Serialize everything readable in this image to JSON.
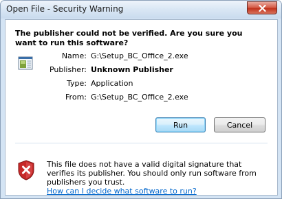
{
  "window": {
    "title": "Open File - Security Warning"
  },
  "main": {
    "heading": "The publisher could not be verified.  Are you sure you want to run this software?",
    "fields": [
      {
        "label": "Name:",
        "value": "G:\\Setup_BC_Office_2.exe",
        "bold": false
      },
      {
        "label": "Publisher:",
        "value": "Unknown Publisher",
        "bold": true
      },
      {
        "label": "Type:",
        "value": "Application",
        "bold": false
      },
      {
        "label": "From:",
        "value": "G:\\Setup_BC_Office_2.exe",
        "bold": false
      }
    ]
  },
  "buttons": {
    "run_label": "Run",
    "cancel_label": "Cancel"
  },
  "footer": {
    "warning_text": "This file does not have a valid digital signature that verifies its publisher.  You should only run software from publishers you trust.",
    "help_link": "How can I decide what software to run?"
  },
  "icons": {
    "close": "close-icon",
    "file": "executable-file-icon",
    "warning": "shield-warning-icon"
  },
  "colors": {
    "link": "#0066cc",
    "shield_red": "#d02a2a",
    "close_button": "#c1331d"
  }
}
